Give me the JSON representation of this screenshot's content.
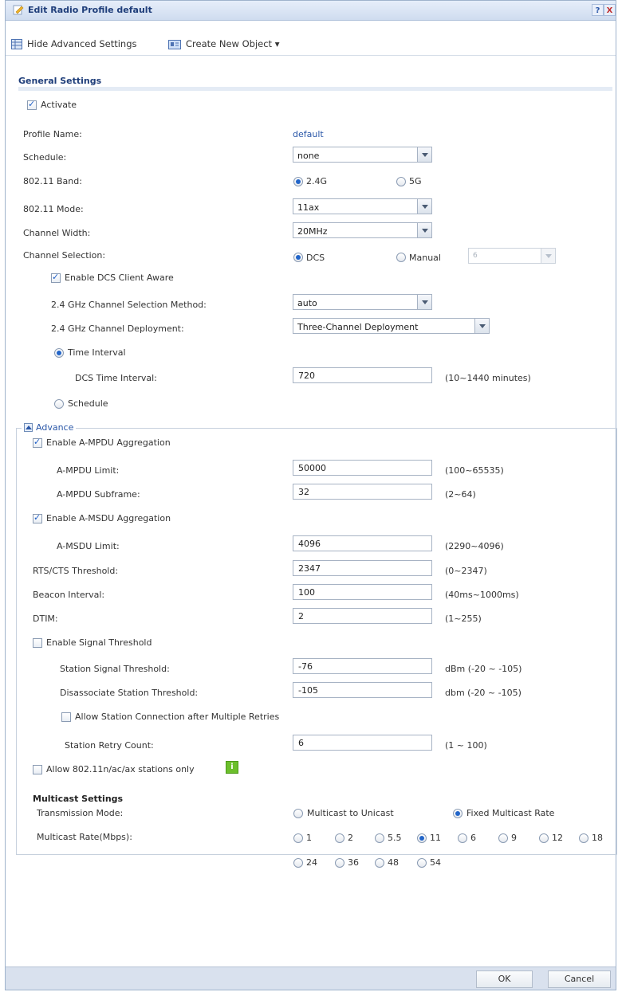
{
  "window": {
    "title": "Edit Radio Profile default",
    "help": "?",
    "close": "X"
  },
  "toolbar": {
    "hide_advanced": "Hide Advanced Settings",
    "create_object": "Create New Object ▾"
  },
  "general": {
    "title": "General Settings",
    "activate": "Activate",
    "profile_name_label": "Profile Name:",
    "profile_name_value": "default",
    "schedule_label": "Schedule:",
    "schedule_value": "none",
    "band_label": "802.11 Band:",
    "band_24": "2.4G",
    "band_5": "5G",
    "mode_label": "802.11 Mode:",
    "mode_value": "11ax",
    "width_label": "Channel Width:",
    "width_value": "20MHz",
    "chsel_label": "Channel Selection:",
    "chsel_dcs": "DCS",
    "chsel_manual": "Manual",
    "manual_channel": "6",
    "dcs_client_aware": "Enable DCS Client Aware",
    "method_label": "2.4 GHz Channel Selection Method:",
    "method_value": "auto",
    "deploy_label": "2.4 GHz Channel Deployment:",
    "deploy_value": "Three-Channel Deployment",
    "time_interval": "Time Interval",
    "dcs_time_label": "DCS Time Interval:",
    "dcs_time_value": "720",
    "dcs_time_range": "(10~1440 minutes)",
    "schedule_radio": "Schedule"
  },
  "advance": {
    "title": "Advance",
    "ampdu": "Enable A-MPDU Aggregation",
    "ampdu_limit_label": "A-MPDU Limit:",
    "ampdu_limit_value": "50000",
    "ampdu_limit_range": "(100~65535)",
    "ampdu_sub_label": "A-MPDU Subframe:",
    "ampdu_sub_value": "32",
    "ampdu_sub_range": "(2~64)",
    "amsdu": "Enable A-MSDU Aggregation",
    "amsdu_limit_label": "A-MSDU Limit:",
    "amsdu_limit_value": "4096",
    "amsdu_limit_range": "(2290~4096)",
    "rts_label": "RTS/CTS Threshold:",
    "rts_value": "2347",
    "rts_range": "(0~2347)",
    "beacon_label": "Beacon Interval:",
    "beacon_value": "100",
    "beacon_range": "(40ms~1000ms)",
    "dtim_label": "DTIM:",
    "dtim_value": "2",
    "dtim_range": "(1~255)",
    "signal": "Enable Signal Threshold",
    "sta_sig_label": "Station Signal Threshold:",
    "sta_sig_value": "-76",
    "sta_sig_range": "dBm (-20 ~ -105)",
    "disassoc_label": "Disassociate Station Threshold:",
    "disassoc_value": "-105",
    "disassoc_range": "dbm (-20 ~ -105)",
    "allow_retry": "Allow Station Connection after Multiple Retries",
    "retry_label": "Station Retry Count:",
    "retry_value": "6",
    "retry_range": "(1 ~ 100)",
    "allow_n": "Allow 802.11n/ac/ax stations only",
    "info_icon": "i"
  },
  "multicast": {
    "title": "Multicast Settings",
    "mode_label": "Transmission Mode:",
    "mode_unicast": "Multicast to Unicast",
    "mode_fixed": "Fixed Multicast Rate",
    "rate_label": "Multicast Rate(Mbps):",
    "rates": [
      "1",
      "2",
      "5.5",
      "11",
      "6",
      "9",
      "12",
      "18",
      "24",
      "36",
      "48",
      "54"
    ],
    "selected_rate": "11"
  },
  "footer": {
    "ok": "OK",
    "cancel": "Cancel"
  },
  "colors": {
    "accent": "#2265c9",
    "title_blue": "#1f3e7a",
    "link_blue": "#2a57a8"
  }
}
